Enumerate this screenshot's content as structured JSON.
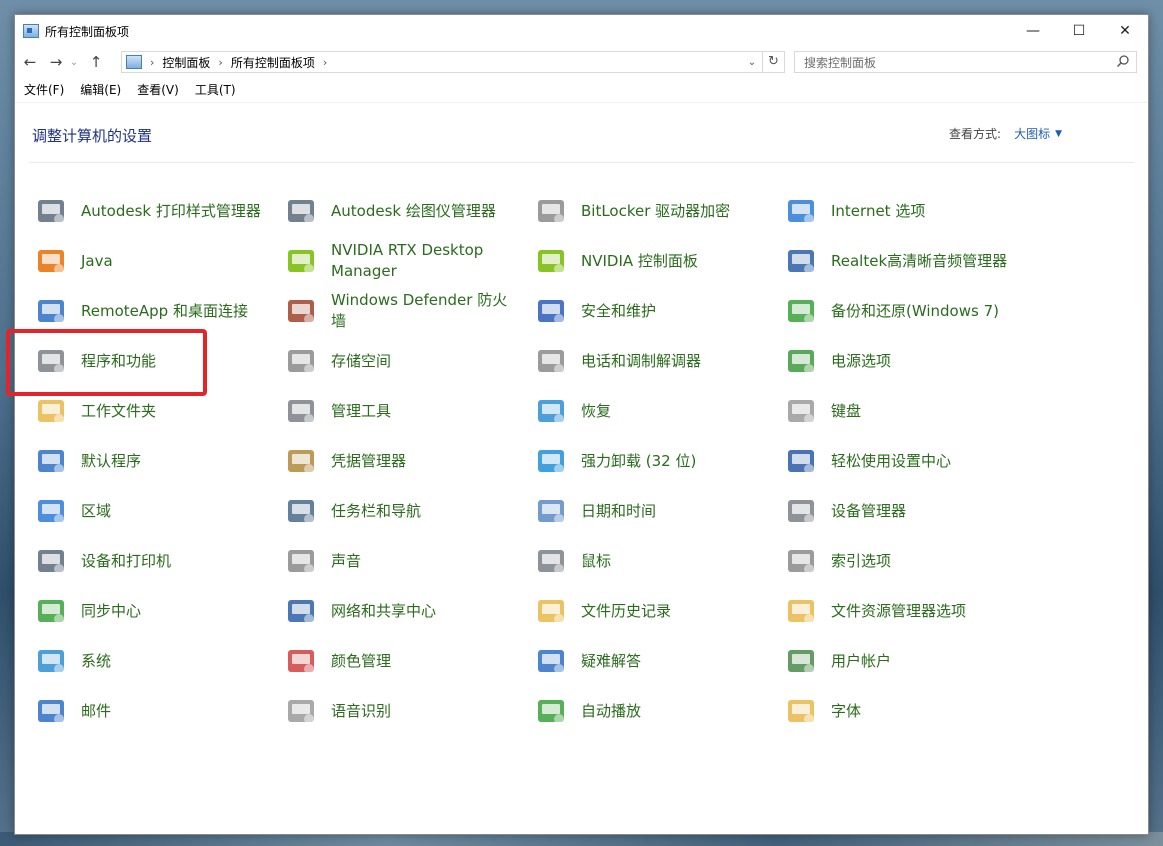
{
  "window": {
    "title": "所有控制面板项",
    "controls": {
      "minimize": "—",
      "maximize": "☐",
      "close": "✕"
    }
  },
  "nav": {
    "back": "←",
    "forward": "→",
    "recent": "⌄",
    "up": "↑"
  },
  "address": {
    "crumbs": [
      "控制面板",
      "所有控制面板项"
    ],
    "separator": "›",
    "dropdown": "⌄",
    "refresh": "↻"
  },
  "search": {
    "placeholder": "搜索控制面板"
  },
  "menu": {
    "file": "文件(F)",
    "edit": "编辑(E)",
    "view": "查看(V)",
    "tools": "工具(T)"
  },
  "content": {
    "heading": "调整计算机的设置",
    "view_by_label": "查看方式:",
    "view_by_value": "大图标",
    "view_by_caret": "▼"
  },
  "items": [
    {
      "label": "Autodesk 打印样式管理器",
      "icon": "printer-style-icon",
      "color": "#5a6a7a"
    },
    {
      "label": "Autodesk 绘图仪管理器",
      "icon": "plotter-icon",
      "color": "#5a6a7a"
    },
    {
      "label": "BitLocker 驱动器加密",
      "icon": "bitlocker-icon",
      "color": "#8a8a8a"
    },
    {
      "label": "Internet 选项",
      "icon": "internet-options-icon",
      "color": "#2e7bd6"
    },
    {
      "label": "Java",
      "icon": "java-icon",
      "color": "#e76f00"
    },
    {
      "label": "NVIDIA RTX Desktop Manager",
      "icon": "nvidia-rtx-icon",
      "color": "#76b900"
    },
    {
      "label": "NVIDIA 控制面板",
      "icon": "nvidia-control-icon",
      "color": "#76b900"
    },
    {
      "label": "Realtek高清晰音频管理器",
      "icon": "realtek-audio-icon",
      "color": "#2b5fa8"
    },
    {
      "label": "RemoteApp 和桌面连接",
      "icon": "remoteapp-icon",
      "color": "#2d6fc4"
    },
    {
      "label": "Windows Defender 防火墙",
      "icon": "firewall-icon",
      "color": "#a0432a"
    },
    {
      "label": "安全和维护",
      "icon": "security-flag-icon",
      "color": "#2c5db8"
    },
    {
      "label": "备份和还原(Windows 7)",
      "icon": "backup-icon",
      "color": "#3aa13a"
    },
    {
      "label": "程序和功能",
      "icon": "programs-features-icon",
      "color": "#7a8088"
    },
    {
      "label": "存储空间",
      "icon": "storage-spaces-icon",
      "color": "#8a8a8a"
    },
    {
      "label": "电话和调制解调器",
      "icon": "phone-modem-icon",
      "color": "#8a8a8a"
    },
    {
      "label": "电源选项",
      "icon": "power-options-icon",
      "color": "#3d9a3d"
    },
    {
      "label": "工作文件夹",
      "icon": "work-folders-icon",
      "color": "#e8b84a"
    },
    {
      "label": "管理工具",
      "icon": "admin-tools-icon",
      "color": "#7a8088"
    },
    {
      "label": "恢复",
      "icon": "recovery-icon",
      "color": "#2d8fd0"
    },
    {
      "label": "键盘",
      "icon": "keyboard-icon",
      "color": "#9a9a9a"
    },
    {
      "label": "默认程序",
      "icon": "default-programs-icon",
      "color": "#2d6fc4"
    },
    {
      "label": "凭据管理器",
      "icon": "credential-manager-icon",
      "color": "#b08a3a"
    },
    {
      "label": "强力卸载 (32 位)",
      "icon": "uninstaller-icon",
      "color": "#1e90d6"
    },
    {
      "label": "轻松使用设置中心",
      "icon": "ease-of-access-icon",
      "color": "#2a5aa8"
    },
    {
      "label": "区域",
      "icon": "region-icon",
      "color": "#2e7bd6"
    },
    {
      "label": "任务栏和导航",
      "icon": "taskbar-icon",
      "color": "#4a6a8a"
    },
    {
      "label": "日期和时间",
      "icon": "date-time-icon",
      "color": "#5a8ac4"
    },
    {
      "label": "设备管理器",
      "icon": "device-manager-icon",
      "color": "#7a8088"
    },
    {
      "label": "设备和打印机",
      "icon": "devices-printers-icon",
      "color": "#5a6a7a"
    },
    {
      "label": "声音",
      "icon": "sound-icon",
      "color": "#8a8a8a"
    },
    {
      "label": "鼠标",
      "icon": "mouse-icon",
      "color": "#7a8088"
    },
    {
      "label": "索引选项",
      "icon": "indexing-icon",
      "color": "#8a8a8a"
    },
    {
      "label": "同步中心",
      "icon": "sync-center-icon",
      "color": "#3aa13a"
    },
    {
      "label": "网络和共享中心",
      "icon": "network-sharing-icon",
      "color": "#2b5fa8"
    },
    {
      "label": "文件历史记录",
      "icon": "file-history-icon",
      "color": "#e8b84a"
    },
    {
      "label": "文件资源管理器选项",
      "icon": "explorer-options-icon",
      "color": "#e8b84a"
    },
    {
      "label": "系统",
      "icon": "system-icon",
      "color": "#2d8fd0"
    },
    {
      "label": "颜色管理",
      "icon": "color-management-icon",
      "color": "#d04040"
    },
    {
      "label": "疑难解答",
      "icon": "troubleshooting-icon",
      "color": "#2d6fc4"
    },
    {
      "label": "用户帐户",
      "icon": "user-accounts-icon",
      "color": "#4a8a4a"
    },
    {
      "label": "邮件",
      "icon": "mail-icon",
      "color": "#2d6fc4"
    },
    {
      "label": "语音识别",
      "icon": "speech-recognition-icon",
      "color": "#9a9a9a"
    },
    {
      "label": "自动播放",
      "icon": "autoplay-icon",
      "color": "#3aa13a"
    },
    {
      "label": "字体",
      "icon": "fonts-icon",
      "color": "#e8b84a"
    }
  ]
}
